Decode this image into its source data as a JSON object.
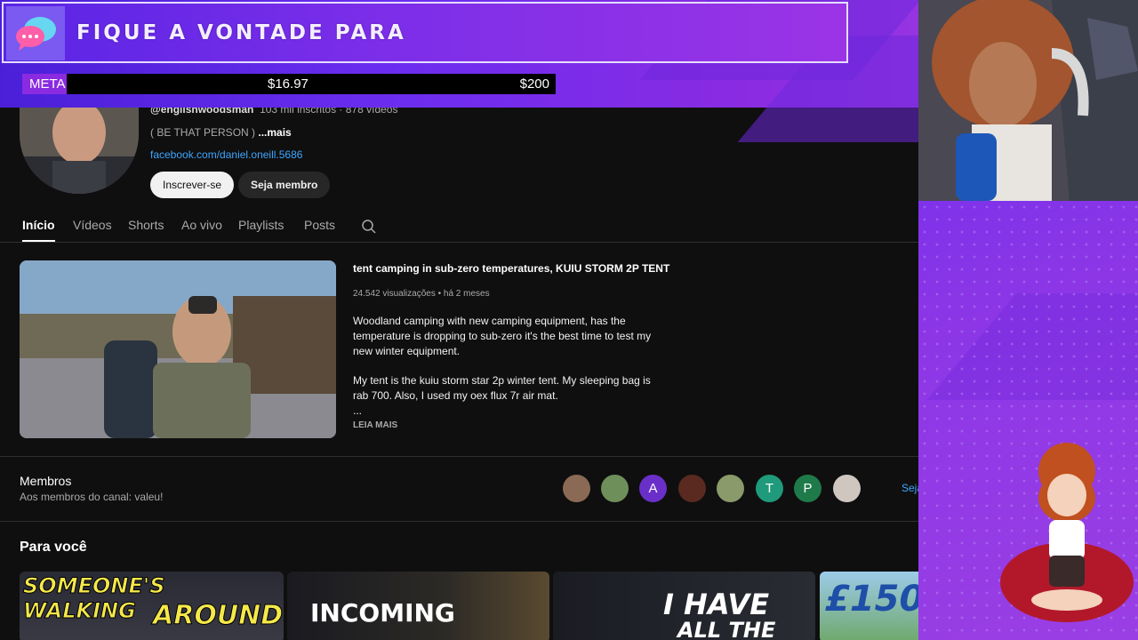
{
  "overlay": {
    "alert_text": "FIQUE A VONTADE PARA",
    "goal": {
      "label": "META",
      "current": "$16.97",
      "target": "$200"
    },
    "accent": "#8a2be2",
    "frame_colors": [
      "#4b1fd8",
      "#a43fe0"
    ]
  },
  "channel": {
    "handle": "@englishwoodsman",
    "stats": "103 mil inscritos · 878 vídeos",
    "description": "( BE THAT PERSON )",
    "more_label": "...mais",
    "link": "facebook.com/daniel.oneill.5686",
    "subscribe_label": "Inscrever-se",
    "join_label": "Seja membro"
  },
  "tabs": [
    {
      "label": "Início",
      "active": true
    },
    {
      "label": "Vídeos",
      "active": false
    },
    {
      "label": "Shorts",
      "active": false
    },
    {
      "label": "Ao vivo",
      "active": false
    },
    {
      "label": "Playlists",
      "active": false
    },
    {
      "label": "Posts",
      "active": false
    }
  ],
  "featured": {
    "title": "tent camping in sub-zero temperatures, KUIU STORM 2P TENT",
    "meta": "24.542 visualizações • há 2 meses",
    "description": "Woodland camping with new camping equipment, has the temperature is dropping to sub-zero it's the best time to test my new winter equipment.\n\nMy tent is the kuiu storm star 2p winter tent. My sleeping bag is rab 700. Also, I used my oex flux 7r air mat.\n...",
    "read_more": "LEIA MAIS"
  },
  "members": {
    "title": "Membros",
    "subtitle": "Aos membros do canal: valeu!",
    "avatars": [
      {
        "initial": "",
        "color": "#8a6a55"
      },
      {
        "initial": "",
        "color": "#6f8f5a"
      },
      {
        "initial": "A",
        "color": "#6a2fc8"
      },
      {
        "initial": "",
        "color": "#5a2a20"
      },
      {
        "initial": "",
        "color": "#8a9a6a"
      },
      {
        "initial": "T",
        "color": "#1f9a7a"
      },
      {
        "initial": "P",
        "color": "#1f7a4a"
      },
      {
        "initial": "",
        "color": "#cfc6c0"
      }
    ],
    "join_link": "Seja"
  },
  "shelf": {
    "title": "Para você",
    "items": [
      {
        "text1": "SOMEONE'S WALKING",
        "text2": "AROUND"
      },
      {
        "text1": "INCOMING"
      },
      {
        "text1": "I HAVE",
        "text2": "ALL THE"
      },
      {
        "text1": "£150"
      }
    ]
  }
}
